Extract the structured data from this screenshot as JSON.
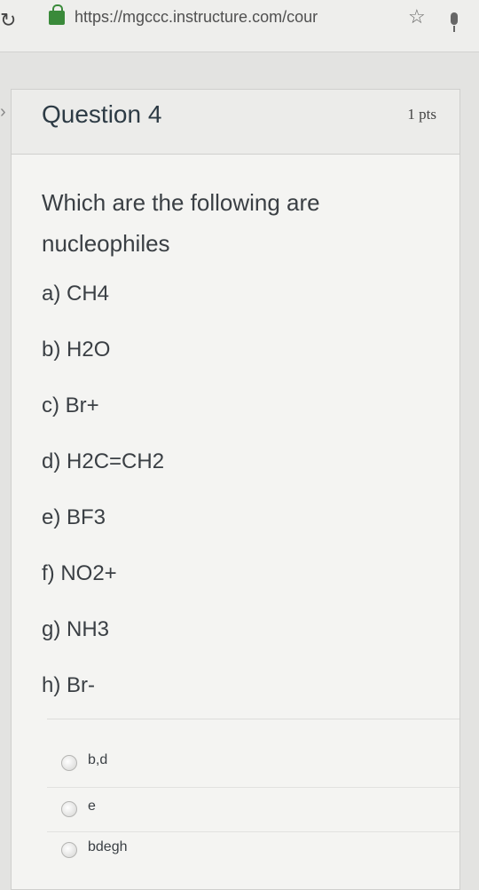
{
  "browser": {
    "url": "https://mgccc.instructure.com/cour"
  },
  "question": {
    "title": "Question 4",
    "points": "1 pts",
    "text": "Which are the following are nucleophiles",
    "options": [
      "a) CH4",
      "b) H2O",
      "c) Br+",
      "d) H2C=CH2",
      "e) BF3",
      "f) NO2+",
      "g) NH3",
      "h) Br-"
    ]
  },
  "answers": [
    {
      "label": "b,d"
    },
    {
      "label": "e"
    },
    {
      "label": "bdegh"
    }
  ]
}
